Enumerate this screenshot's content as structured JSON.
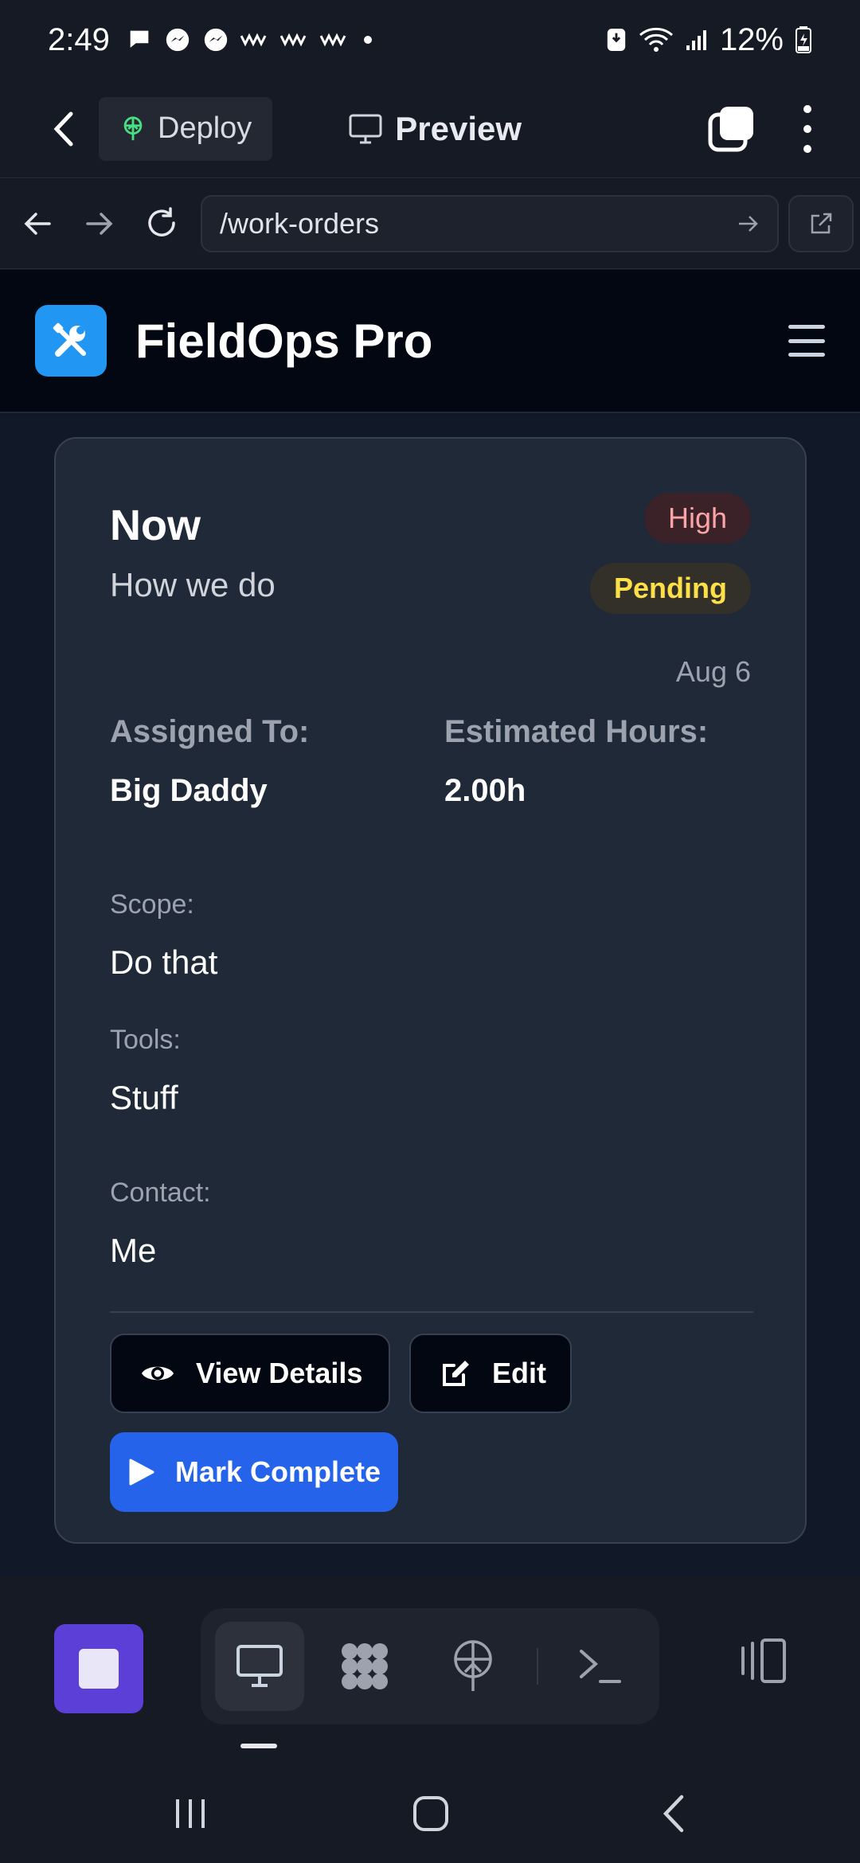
{
  "status_bar": {
    "time": "2:49",
    "battery": "12%"
  },
  "toolbar": {
    "deploy_label": "Deploy",
    "preview_label": "Preview"
  },
  "url_bar": {
    "path": "/work-orders"
  },
  "site": {
    "title": "FieldOps Pro",
    "logo_icon": "tools-icon",
    "accent": "#2196f3"
  },
  "work_order": {
    "title": "Now",
    "subtitle": "How we do",
    "priority": "High",
    "status": "Pending",
    "date": "Aug 6",
    "assigned_label": "Assigned To:",
    "assigned_value": "Big Daddy",
    "hours_label": "Estimated Hours:",
    "hours_value": "2.00h",
    "scope_label": "Scope:",
    "scope_value": "Do that",
    "tools_label": "Tools:",
    "tools_value": "Stuff",
    "contact_label": "Contact:",
    "contact_value": "Me",
    "priority_color": "#fca5a5",
    "status_color": "#fde047"
  },
  "actions": {
    "view_details": "View Details",
    "edit": "Edit",
    "mark_complete": "Mark Complete",
    "primary_color": "#2563eb"
  },
  "ide_bar": {
    "stop_color": "#5b3fd6",
    "modes": [
      "desktop-icon",
      "extensions-icon",
      "deploy-icon",
      "terminal-icon"
    ],
    "active_mode": "desktop-icon"
  }
}
